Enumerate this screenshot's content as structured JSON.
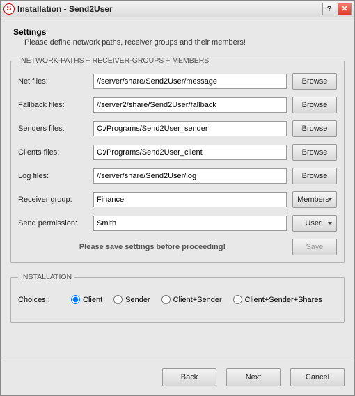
{
  "window": {
    "title": "Installation - Send2User",
    "icon_letter": "S"
  },
  "header": {
    "title": "Settings",
    "subtitle": "Please define network paths, receiver groups and their members!"
  },
  "group1": {
    "legend": "NETWORK-PATHS + RECEIVER-GROUPS + MEMBERS",
    "rows": {
      "net": {
        "label": "Net files:",
        "value": "//server/share/Send2User/message",
        "btn": "Browse"
      },
      "fallback": {
        "label": "Fallback files:",
        "value": "//server2/share/Send2User/fallback",
        "btn": "Browse"
      },
      "senders": {
        "label": "Senders files:",
        "value": "C:/Programs/Send2User_sender",
        "btn": "Browse"
      },
      "clients": {
        "label": "Clients files:",
        "value": "C:/Programs/Send2User_client",
        "btn": "Browse"
      },
      "log": {
        "label": "Log files:",
        "value": "//server/share/Send2User/log",
        "btn": "Browse"
      },
      "recv": {
        "label": "Receiver group:",
        "value": "Finance",
        "btn": "Members"
      },
      "perm": {
        "label": "Send permission:",
        "value": "Smith",
        "btn": "User"
      }
    },
    "save_hint": "Please save settings before proceeding!",
    "save_btn": "Save"
  },
  "group2": {
    "legend": "INSTALLATION",
    "choices_label": "Choices :",
    "options": [
      "Client",
      "Sender",
      "Client+Sender",
      "Client+Sender+Shares"
    ],
    "selected": "Client"
  },
  "footer": {
    "back": "Back",
    "next": "Next",
    "cancel": "Cancel"
  }
}
